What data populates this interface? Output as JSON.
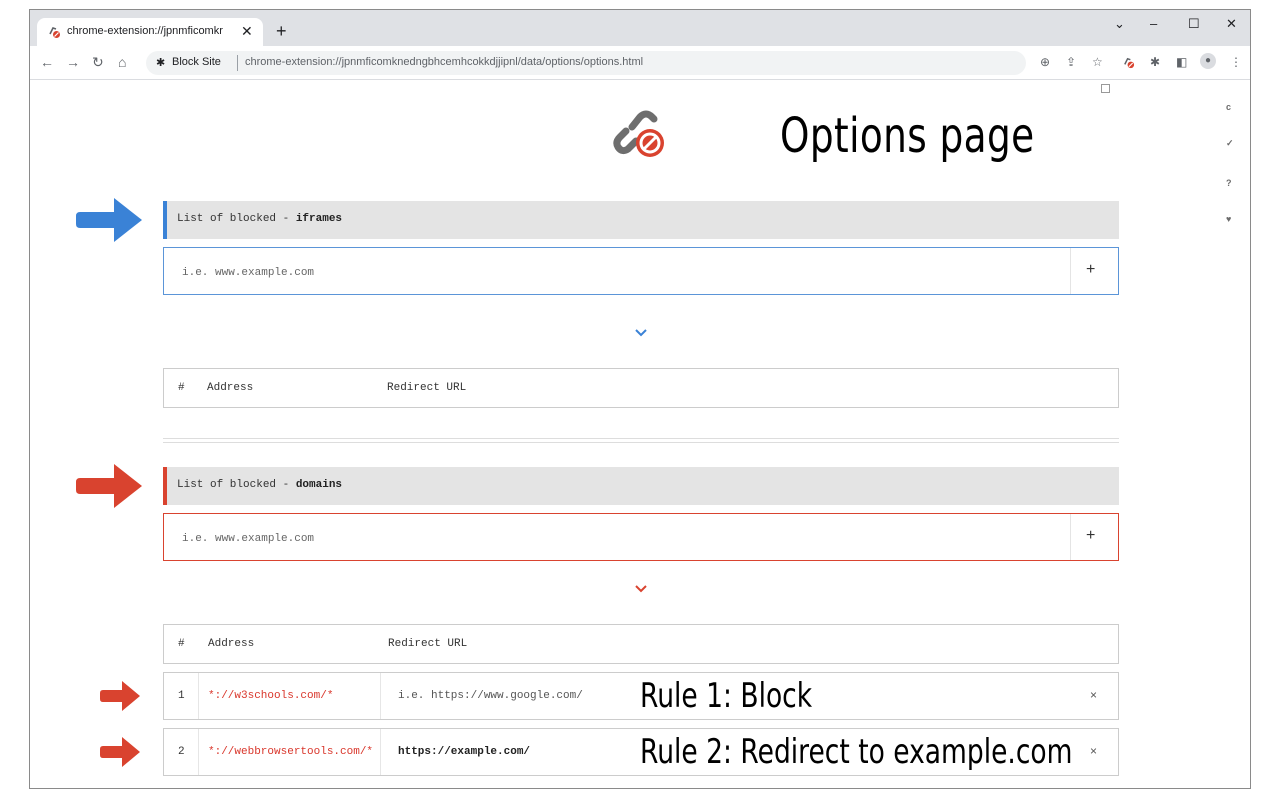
{
  "browser": {
    "tab_title": "chrome-extension://jpnmficomkr",
    "tab_close": "✕",
    "new_tab": "+",
    "window_controls": {
      "dropdown": "⌄",
      "minimize": "–",
      "maximize": "☐",
      "close": "✕"
    },
    "site_label": "Block Site",
    "url": "chrome-extension://jpnmficomknedngbhcemhcokkdjjipnl/data/options/options.html",
    "icons": [
      "back-icon",
      "forward-icon",
      "reload-icon",
      "home-icon",
      "zoom-icon",
      "share-icon",
      "star-icon",
      "blocksite-icon",
      "extensions-icon",
      "sidepanel-icon",
      "profile-icon",
      "menu-icon"
    ]
  },
  "page": {
    "title": "Options page",
    "side_icons": [
      "c",
      "✓",
      "?",
      "♥"
    ]
  },
  "iframes_section": {
    "label_prefix": "List of blocked - ",
    "label_bold": "iframes",
    "placeholder": "i.e. www.example.com",
    "add_label": "+",
    "accent": "#3a82d6"
  },
  "domains_section": {
    "label_prefix": "List of blocked - ",
    "label_bold": "domains",
    "placeholder": "i.e. www.example.com",
    "add_label": "+",
    "accent": "#d9432f"
  },
  "table": {
    "col_num": "#",
    "col_address": "Address",
    "col_redirect": "Redirect URL"
  },
  "rules": [
    {
      "num": "1",
      "address": "*://w3schools.com/*",
      "redirect": "i.e. https://www.google.com/",
      "annotation": "Rule 1: Block",
      "delete": "×"
    },
    {
      "num": "2",
      "address": "*://webbrowsertools.com/*",
      "redirect": "https://example.com/",
      "annotation": "Rule 2: Redirect to example.com",
      "delete": "×"
    }
  ]
}
